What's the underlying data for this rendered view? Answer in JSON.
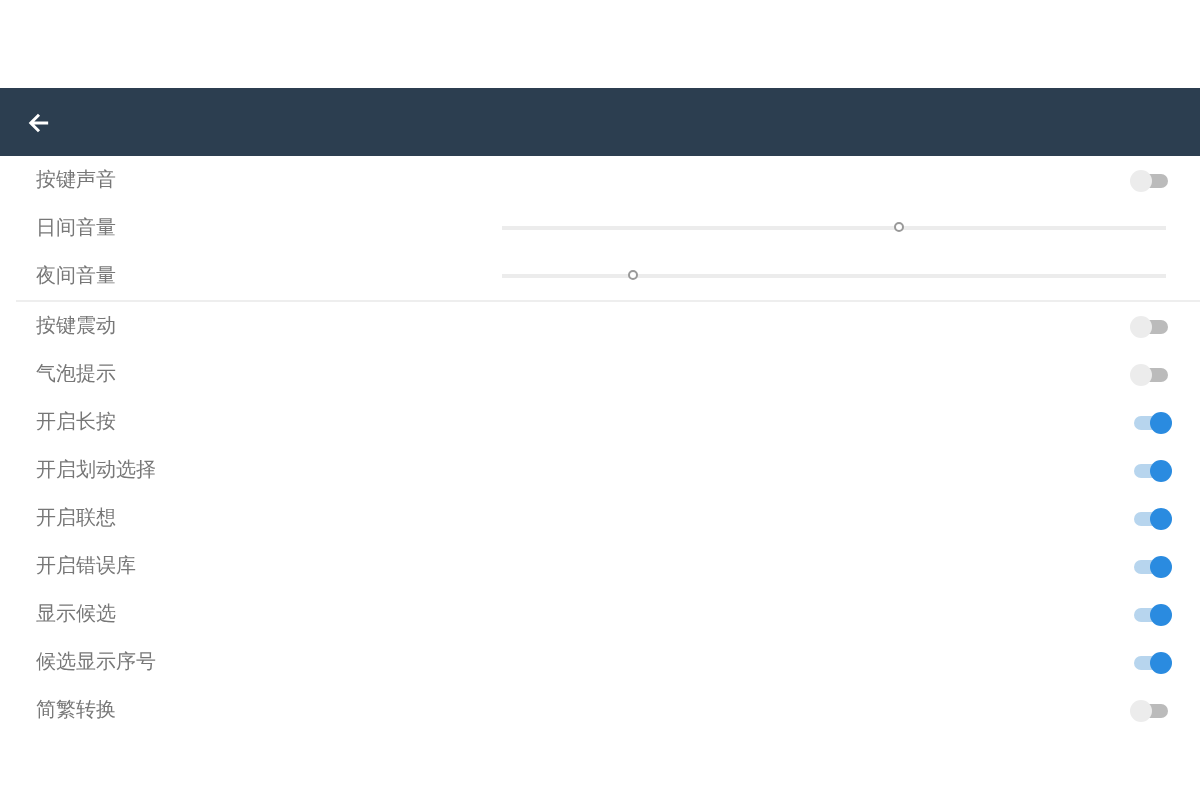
{
  "sections": [
    {
      "items": [
        {
          "kind": "toggle",
          "label": "按键声音",
          "on": false
        },
        {
          "kind": "slider",
          "label": "日间音量",
          "level": 0.6
        },
        {
          "kind": "slider",
          "label": "夜间音量",
          "level": 0.2
        }
      ]
    },
    {
      "items": [
        {
          "kind": "toggle",
          "label": "按键震动",
          "on": false
        },
        {
          "kind": "toggle",
          "label": "气泡提示",
          "on": false
        },
        {
          "kind": "toggle",
          "label": "开启长按",
          "on": true
        },
        {
          "kind": "toggle",
          "label": "开启划动选择",
          "on": true
        },
        {
          "kind": "toggle",
          "label": "开启联想",
          "on": true
        },
        {
          "kind": "toggle",
          "label": "开启错误库",
          "on": true
        },
        {
          "kind": "toggle",
          "label": "显示候选",
          "on": true
        },
        {
          "kind": "toggle",
          "label": "候选显示序号",
          "on": true
        },
        {
          "kind": "toggle",
          "label": "简繁转换",
          "on": false
        }
      ]
    }
  ]
}
